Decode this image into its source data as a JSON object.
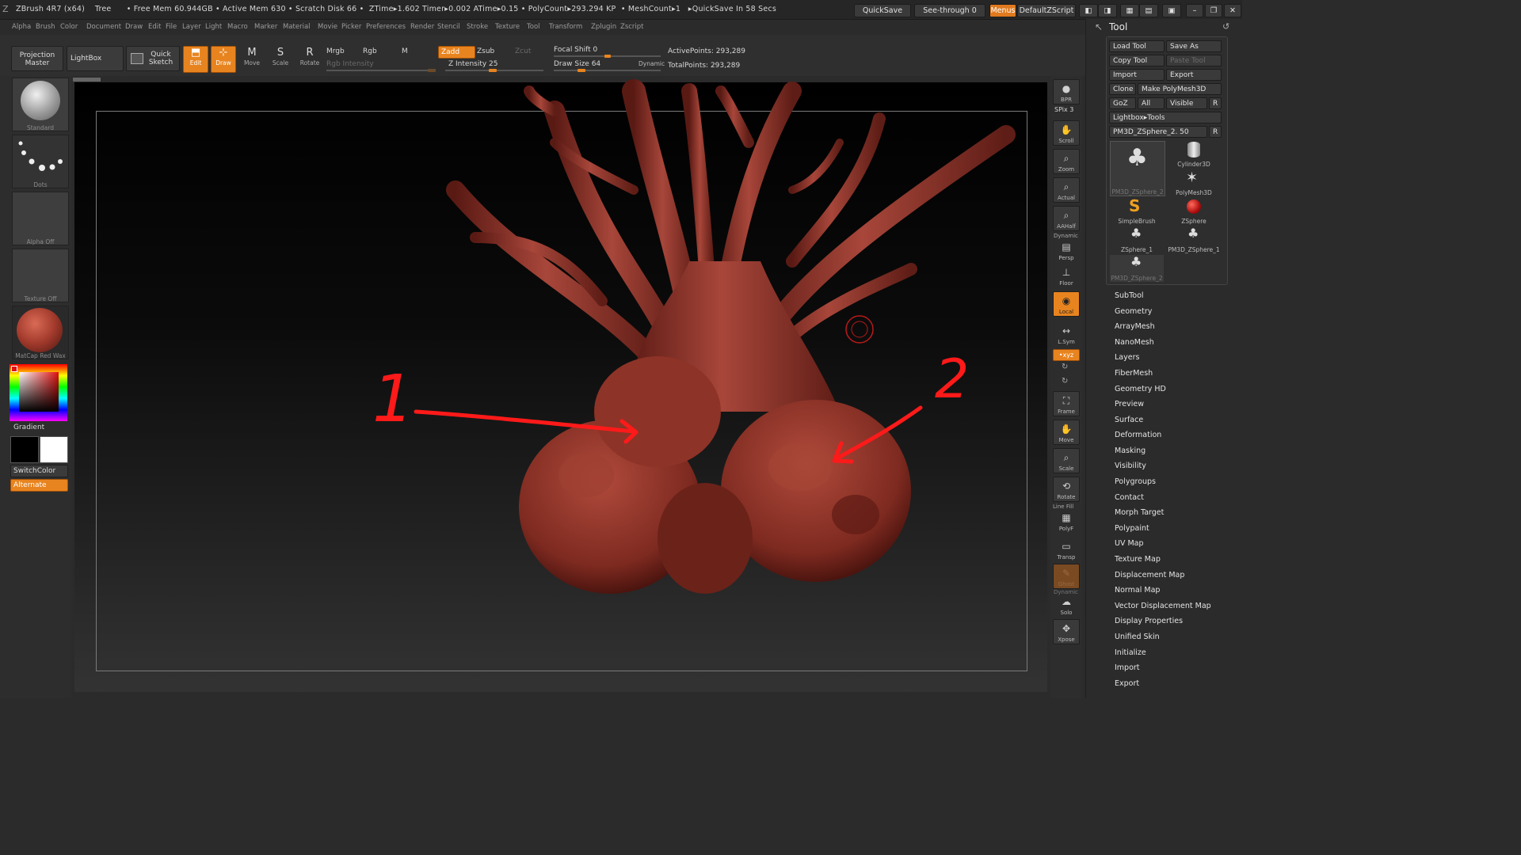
{
  "titlebar": {
    "text": "ZBrush 4R7 (x64)    Tree      • Free Mem 60.944GB • Active Mem 630 • Scratch Disk 66 •  ZTime▸1.602 Timer▸0.002 ATime▸0.15 • PolyCount▸293.294 KP  • MeshCount▸1   ▸QuickSave In 58 Secs",
    "quicksave": "QuickSave",
    "see_through": "See-through  0",
    "menus": "Menus",
    "script": "DefaultZScript"
  },
  "menubar": [
    "Alpha",
    "Brush",
    "Color",
    "Document",
    "Draw",
    "Edit",
    "File",
    "Layer",
    "Light",
    "Macro",
    "Marker",
    "Material",
    "Movie",
    "Picker",
    "Preferences",
    "Render",
    "Stencil",
    "Stroke",
    "Texture",
    "Tool",
    "Transform",
    "Zplugin",
    "Zscript"
  ],
  "shelf": {
    "projection_master": "Projection Master",
    "lightbox": "LightBox",
    "quick_sketch": "Quick Sketch",
    "edit": "Edit",
    "draw": "Draw",
    "move": "Move",
    "scale": "Scale",
    "rotate": "Rotate",
    "mrgb": "Mrgb",
    "rgb": "Rgb",
    "m": "M",
    "rgb_intensity": "Rgb  Intensity",
    "zadd": "Zadd",
    "zsub": "Zsub",
    "zcut": "Zcut",
    "z_intensity": "Z Intensity 25",
    "focal_shift": "Focal Shift 0",
    "draw_size": "Draw Size 64",
    "dynamic": "Dynamic",
    "active_points": "ActivePoints: 293,289",
    "total_points": "TotalPoints: 293,289"
  },
  "left_panel": {
    "brush": "Standard",
    "stroke": "Dots",
    "alpha": "Alpha  Off",
    "texture": "Texture  Off",
    "material": "MatCap  Red  Wax",
    "gradient": "Gradient",
    "switch_color": "SwitchColor",
    "alternate": "Alternate"
  },
  "right_shelf": [
    {
      "name": "bpr",
      "label": "BPR"
    },
    {
      "name": "spix",
      "label": "SPix 3"
    },
    {
      "name": "scroll",
      "label": "Scroll"
    },
    {
      "name": "zoom",
      "label": "Zoom"
    },
    {
      "name": "actual",
      "label": "Actual"
    },
    {
      "name": "aahalf",
      "label": "AAHalf"
    },
    {
      "name": "persp",
      "label": "Persp"
    },
    {
      "name": "floor",
      "label": "Floor"
    },
    {
      "name": "local",
      "label": "Local"
    },
    {
      "name": "lsym",
      "label": "L.Sym"
    },
    {
      "name": "xyz",
      "label": "•xyz"
    },
    {
      "name": "frame",
      "label": "Frame"
    },
    {
      "name": "move",
      "label": "Move"
    },
    {
      "name": "scale",
      "label": "Scale"
    },
    {
      "name": "rotate",
      "label": "Rotate"
    },
    {
      "name": "polyf",
      "label": "PolyF"
    },
    {
      "name": "transp",
      "label": "Transp"
    },
    {
      "name": "ghost",
      "label": "Ghost"
    },
    {
      "name": "solo",
      "label": "Solo"
    },
    {
      "name": "xpose",
      "label": "Xpose"
    }
  ],
  "right_shelf_extras": {
    "dynamic": "Dynamic",
    "line_fill": "Line Fill",
    "dynamic2": "Dynamic"
  },
  "tool_palette": {
    "title": "Tool",
    "load_tool": "Load Tool",
    "save_as": "Save As",
    "copy_tool": "Copy Tool",
    "paste_tool": "Paste Tool",
    "import": "Import",
    "export": "Export",
    "clone": "Clone",
    "make_polymesh": "Make PolyMesh3D",
    "goz": "GoZ",
    "all": "All",
    "visible": "Visible",
    "r": "R",
    "lightbox_tools": "Lightbox▸Tools",
    "current_tool": "PM3D_ZSphere_2. 50",
    "tools": [
      "PM3D_ZSphere_2",
      "Cylinder3D",
      "PolyMesh3D",
      "SimpleBrush",
      "ZSphere",
      "ZSphere_1",
      "PM3D_ZSphere_1",
      "PM3D_ZSphere_2"
    ],
    "sections": [
      "SubTool",
      "Geometry",
      "ArrayMesh",
      "NanoMesh",
      "Layers",
      "FiberMesh",
      "Geometry HD",
      "Preview",
      "Surface",
      "Deformation",
      "Masking",
      "Visibility",
      "Polygroups",
      "Contact",
      "Morph Target",
      "Polypaint",
      "UV Map",
      "Texture Map",
      "Displacement Map",
      "Normal Map",
      "Vector Displacement Map",
      "Display Properties",
      "Unified Skin",
      "Initialize",
      "Import",
      "Export"
    ]
  },
  "annotations": {
    "one": "1",
    "two": "2"
  },
  "colors": {
    "accent": "#e8841f",
    "model": "#8c3026",
    "annotation": "#ff1a1a"
  }
}
